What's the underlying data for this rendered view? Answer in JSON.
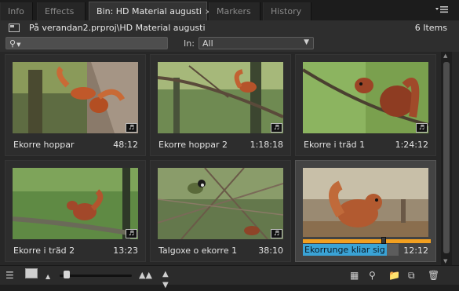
{
  "tabs": [
    {
      "label": "Info"
    },
    {
      "label": "Effects"
    },
    {
      "label": "Bin: HD Material augusti",
      "close": "×"
    },
    {
      "label": "Markers"
    },
    {
      "label": "History"
    }
  ],
  "panel_menu_icon": "panel-menu-icon",
  "path": {
    "text": "På verandan2.prproj\\HD Material augusti",
    "count": "6 Items"
  },
  "search": {
    "value": "",
    "in_label": "In:",
    "in_value": "All"
  },
  "clips": [
    {
      "name": "Ekorre hoppar",
      "duration": "48:12",
      "audio": true,
      "scene": "squirrel-trunk"
    },
    {
      "name": "Ekorre hoppar 2",
      "duration": "1:18:18",
      "audio": true,
      "scene": "squirrel-branch"
    },
    {
      "name": "Ekorre i träd 1",
      "duration": "1:24:12",
      "audio": true,
      "scene": "squirrel-closeup"
    },
    {
      "name": "Ekorre i träd 2",
      "duration": "13:23",
      "audio": true,
      "scene": "squirrel-log"
    },
    {
      "name": "Talgoxe o ekorre 1",
      "duration": "38:10",
      "audio": true,
      "scene": "bird-branches"
    },
    {
      "name": "Ekorrunge kliar sig",
      "duration": "12:12",
      "audio": false,
      "scene": "squirrel-bench",
      "selected": true,
      "editing": true,
      "playhead": 0.63
    }
  ],
  "toolbar": {
    "icons": [
      "list-view-icon",
      "icon-view-icon",
      "zoom-small-icon",
      "zoom-large-icon",
      "sort-icon",
      "automate-icon",
      "find-icon",
      "new-bin-icon",
      "new-item-icon",
      "clear-icon"
    ],
    "zoom_level": 0.05
  },
  "colors": {
    "accent_selection": "#3aa3d6",
    "scrub_bar": "#f2a020",
    "panel_bg": "#272727"
  }
}
